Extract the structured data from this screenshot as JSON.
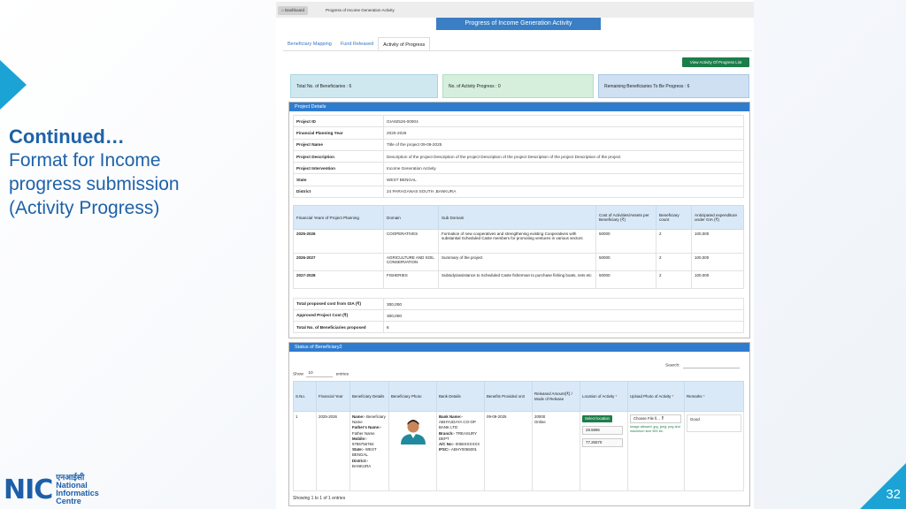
{
  "slide": {
    "heading": "Continued…",
    "description": "Format for Income progress submission (Activity Progress)",
    "page_number": "32",
    "logo_hindi": "एनआईसी",
    "logo_en_1": "National",
    "logo_en_2": "Informatics",
    "logo_en_3": "Centre",
    "logo_mark": "NIC"
  },
  "breadcrumb": {
    "home": "Dashboard",
    "current": "Progress of Income Generation Activity"
  },
  "page_title": "Progress of Income Generation Activity",
  "tabs": [
    {
      "label": "Beneficiary Mapping"
    },
    {
      "label": "Fund Released"
    },
    {
      "label": "Activity of Progress"
    }
  ],
  "view_button": "View Activity Of Progress List",
  "stats": {
    "total": "Total No. of Beneficiaries : 6",
    "activity": "No. of Activity Progress : 0",
    "remaining": "Remaining Beneficiaries To Be Progress : 6"
  },
  "project_details": {
    "heading": "Project Details",
    "rows": [
      {
        "label": "Project ID",
        "value": "GIA92526-00904"
      },
      {
        "label": "Financial Planning Year",
        "value": "2025-2026"
      },
      {
        "label": "Project Name",
        "value": "Title of the project 09-09-2025"
      },
      {
        "label": "Project Description",
        "value": "Description of the project Description of the project Description of the project Description of the project Description of the project"
      },
      {
        "label": "Project Intervention",
        "value": "Income Generation Activity"
      },
      {
        "label": "State",
        "value": "WEST BENGAL"
      },
      {
        "label": "District",
        "value": "24 PARAGANAS SOUTH ,BANKURA"
      }
    ],
    "fy_headers": [
      "Financial Years of Project Planning",
      "Domain",
      "Sub Domain",
      "Cost of Activities/Assets per Beneficiary (₹)",
      "Beneficiary count",
      "Anticipated expenditure under GIA (₹)"
    ],
    "fy_rows": [
      {
        "year": "2025-2026",
        "domain": "COOPERATIVES",
        "sub": "Formation of new cooperatives and strengthening existing Cooperatives with substantial Scheduled Caste members for promoting ventures in various sectors",
        "cost": "50000",
        "count": "2",
        "exp": "100,000"
      },
      {
        "year": "2026-2027",
        "domain": "AGRICULTURE AND SOIL CONSERVATION",
        "sub": "Summary of the project",
        "cost": "50000",
        "count": "2",
        "exp": "100,000"
      },
      {
        "year": "2027-2028",
        "domain": "FISHERIES",
        "sub": "Subsidy/assistance to Scheduled Caste fisherman to purchase fishing boats, nets etc",
        "cost": "50000",
        "count": "2",
        "exp": "100,000"
      }
    ],
    "totals": [
      {
        "label": "Total proposed cost from GIA (₹)",
        "value": "300,000"
      },
      {
        "label": "Approved Project Cost (₹)",
        "value": "300,000"
      },
      {
        "label": "Total No. of Beneficiaries proposed",
        "value": "6"
      }
    ]
  },
  "status": {
    "heading": "Status of Beneficiary2",
    "show_label": "Show",
    "show_value": "10",
    "entries_label": "entries",
    "search_label": "Search:",
    "headers": [
      "S.No.",
      "Financial Year",
      "Beneficiary Details",
      "Beneficiary Photo",
      "Bank Details",
      "Benefits Provided on3",
      "Released Amount(₹) / Mode of Release",
      "Location of Activity",
      "Upload Photo of Activity",
      "Remarks"
    ],
    "row": {
      "sno": "1",
      "year": "2025-2026",
      "name_label": "Name:-",
      "name": "Beneficiary Name",
      "father_label": "Father's Name:-",
      "father": "Father Name",
      "mobile_label": "Mobile:-",
      "mobile": "9786756784",
      "state_label": "State:-",
      "state": "WEST BENGAL",
      "district_label": "District:-",
      "district": "BANKURA",
      "bank_name_label": "Bank Name:-",
      "bank_name": "ABHYUDAYA CO-OP BANK LTD",
      "branch_label": "Branch:-",
      "branch": "TREASURY DEPT",
      "acno_label": "A/C No:-",
      "acno": "0056XXXXXX",
      "ifsc_label": "IFSC:-",
      "ifsc": "ABHY0065001",
      "benefit_date": "09-09-2025",
      "amount": "20000",
      "mode": "Online",
      "location_button": "Select location",
      "lat": "28.5896",
      "lng": "77.26570",
      "choose_file": "Choose File",
      "file_name": "fi...",
      "file_hint": "Image allowed: jpg, jpeg, png and maximum size 500 kb.",
      "remarks": "Good"
    },
    "showing": "Showing 1 to 1 of 1 entries"
  }
}
